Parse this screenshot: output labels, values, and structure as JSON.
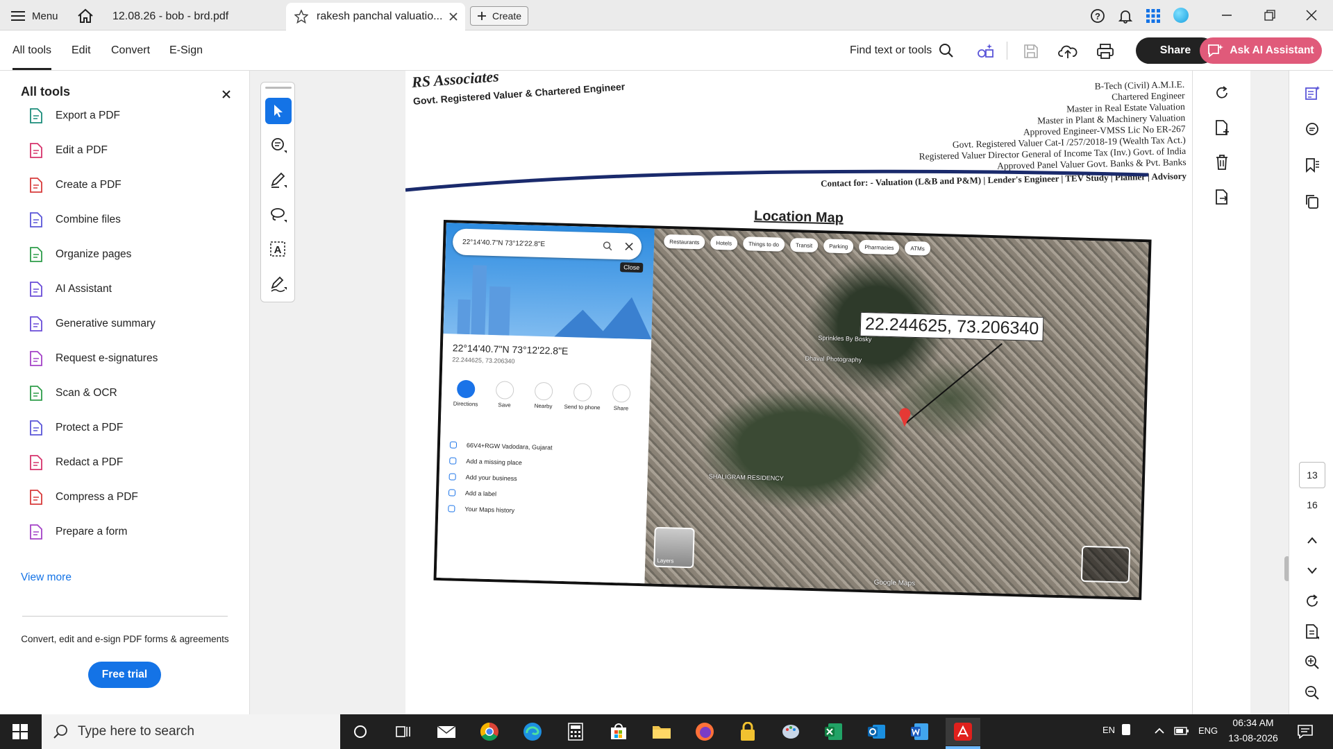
{
  "titlebar": {
    "menu_label": "Menu",
    "tabs": [
      {
        "label": "12.08.26 - bob - brd.pdf"
      },
      {
        "label": "rakesh panchal valuatio..."
      }
    ],
    "create_label": "Create"
  },
  "toolbar": {
    "tabs": [
      "All tools",
      "Edit",
      "Convert",
      "E-Sign"
    ],
    "find_label": "Find text or tools",
    "share_label": "Share",
    "ai_label": "Ask AI Assistant"
  },
  "left_panel": {
    "title": "All tools",
    "items": [
      {
        "label": "Export a PDF",
        "icon": "export-pdf-icon",
        "color": "#1a8c7a"
      },
      {
        "label": "Edit a PDF",
        "icon": "edit-pdf-icon",
        "color": "#d6336c"
      },
      {
        "label": "Create a PDF",
        "icon": "create-pdf-icon",
        "color": "#d83b3b"
      },
      {
        "label": "Combine files",
        "icon": "combine-files-icon",
        "color": "#5a55d8"
      },
      {
        "label": "Organize pages",
        "icon": "organize-pages-icon",
        "color": "#2e9d4a"
      },
      {
        "label": "AI Assistant",
        "icon": "ai-assistant-icon",
        "color": "#6a4cd8"
      },
      {
        "label": "Generative summary",
        "icon": "generative-summary-icon",
        "color": "#6a4cd8"
      },
      {
        "label": "Request e-signatures",
        "icon": "request-esignatures-icon",
        "color": "#a442c7"
      },
      {
        "label": "Scan & OCR",
        "icon": "scan-ocr-icon",
        "color": "#2e9d4a"
      },
      {
        "label": "Protect a PDF",
        "icon": "protect-pdf-icon",
        "color": "#5a55d8"
      },
      {
        "label": "Redact a PDF",
        "icon": "redact-pdf-icon",
        "color": "#d6336c"
      },
      {
        "label": "Compress a PDF",
        "icon": "compress-pdf-icon",
        "color": "#d83b3b"
      },
      {
        "label": "Prepare a form",
        "icon": "prepare-form-icon",
        "color": "#a442c7"
      }
    ],
    "view_more": "View more",
    "promo_text": "Convert, edit and e-sign PDF forms & agreements",
    "free_trial": "Free trial"
  },
  "document": {
    "firm_name": "RS Associates",
    "firm_sub": "Govt. Registered Valuer & Chartered Engineer",
    "cred_lines": [
      "B-Tech (Civil) A.M.I.E.",
      "Chartered Engineer",
      "Master in Real Estate Valuation",
      "Master in Plant & Machinery Valuation",
      "Approved Engineer-VMSS Lic No ER-267",
      "Govt. Registered Valuer Cat-I /257/2018-19 (Wealth Tax Act.)",
      "Registered Valuer Director General of Income Tax (Inv.) Govt. of India",
      "Approved Panel Valuer Govt. Banks & Pvt. Banks",
      "Contact for: - Valuation (L&B and P&M) | Lender's Engineer | TEV Study | Planner | Advisory"
    ],
    "section_title": "Location Map",
    "map": {
      "search_value": "22°14'40.7\"N 73°12'22.8\"E",
      "close_label": "Close",
      "coord_title": "22°14'40.7\"N 73°12'22.8\"E",
      "coord_decimal": "22.244625, 73.206340",
      "actions": [
        "Directions",
        "Save",
        "Nearby",
        "Send to phone",
        "Share"
      ],
      "list": [
        "66V4+RGW Vadodara, Gujarat",
        "Add a missing place",
        "Add your business",
        "Add a label",
        "Your Maps history"
      ],
      "chips": [
        "Restaurants",
        "Hotels",
        "Things to do",
        "Transit",
        "Parking",
        "Pharmacies",
        "ATMs"
      ],
      "callout": "22.244625, 73.206340",
      "places": [
        "Sprinkles By Bosky",
        "Dhaval Photography",
        "SHALIGRAM RESIDENCY",
        "Google Maps",
        "Layers"
      ]
    }
  },
  "page_nav": {
    "current": "13",
    "total": "16"
  },
  "taskbar": {
    "search_placeholder": "Type here to search",
    "lang": "EN",
    "keyboard": "ENG",
    "time": "06:34 AM",
    "date": "13-08-2026"
  },
  "colors": {
    "accent": "#1473e6",
    "ai_button": "#e05a7a",
    "share_button": "#222222"
  }
}
